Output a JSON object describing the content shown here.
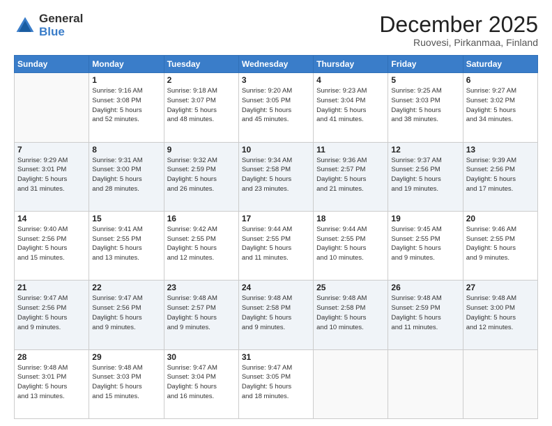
{
  "logo": {
    "general": "General",
    "blue": "Blue"
  },
  "header": {
    "month": "December 2025",
    "location": "Ruovesi, Pirkanmaa, Finland"
  },
  "weekdays": [
    "Sunday",
    "Monday",
    "Tuesday",
    "Wednesday",
    "Thursday",
    "Friday",
    "Saturday"
  ],
  "weeks": [
    [
      {
        "day": "",
        "info": ""
      },
      {
        "day": "1",
        "info": "Sunrise: 9:16 AM\nSunset: 3:08 PM\nDaylight: 5 hours\nand 52 minutes."
      },
      {
        "day": "2",
        "info": "Sunrise: 9:18 AM\nSunset: 3:07 PM\nDaylight: 5 hours\nand 48 minutes."
      },
      {
        "day": "3",
        "info": "Sunrise: 9:20 AM\nSunset: 3:05 PM\nDaylight: 5 hours\nand 45 minutes."
      },
      {
        "day": "4",
        "info": "Sunrise: 9:23 AM\nSunset: 3:04 PM\nDaylight: 5 hours\nand 41 minutes."
      },
      {
        "day": "5",
        "info": "Sunrise: 9:25 AM\nSunset: 3:03 PM\nDaylight: 5 hours\nand 38 minutes."
      },
      {
        "day": "6",
        "info": "Sunrise: 9:27 AM\nSunset: 3:02 PM\nDaylight: 5 hours\nand 34 minutes."
      }
    ],
    [
      {
        "day": "7",
        "info": "Sunrise: 9:29 AM\nSunset: 3:01 PM\nDaylight: 5 hours\nand 31 minutes."
      },
      {
        "day": "8",
        "info": "Sunrise: 9:31 AM\nSunset: 3:00 PM\nDaylight: 5 hours\nand 28 minutes."
      },
      {
        "day": "9",
        "info": "Sunrise: 9:32 AM\nSunset: 2:59 PM\nDaylight: 5 hours\nand 26 minutes."
      },
      {
        "day": "10",
        "info": "Sunrise: 9:34 AM\nSunset: 2:58 PM\nDaylight: 5 hours\nand 23 minutes."
      },
      {
        "day": "11",
        "info": "Sunrise: 9:36 AM\nSunset: 2:57 PM\nDaylight: 5 hours\nand 21 minutes."
      },
      {
        "day": "12",
        "info": "Sunrise: 9:37 AM\nSunset: 2:56 PM\nDaylight: 5 hours\nand 19 minutes."
      },
      {
        "day": "13",
        "info": "Sunrise: 9:39 AM\nSunset: 2:56 PM\nDaylight: 5 hours\nand 17 minutes."
      }
    ],
    [
      {
        "day": "14",
        "info": "Sunrise: 9:40 AM\nSunset: 2:56 PM\nDaylight: 5 hours\nand 15 minutes."
      },
      {
        "day": "15",
        "info": "Sunrise: 9:41 AM\nSunset: 2:55 PM\nDaylight: 5 hours\nand 13 minutes."
      },
      {
        "day": "16",
        "info": "Sunrise: 9:42 AM\nSunset: 2:55 PM\nDaylight: 5 hours\nand 12 minutes."
      },
      {
        "day": "17",
        "info": "Sunrise: 9:44 AM\nSunset: 2:55 PM\nDaylight: 5 hours\nand 11 minutes."
      },
      {
        "day": "18",
        "info": "Sunrise: 9:44 AM\nSunset: 2:55 PM\nDaylight: 5 hours\nand 10 minutes."
      },
      {
        "day": "19",
        "info": "Sunrise: 9:45 AM\nSunset: 2:55 PM\nDaylight: 5 hours\nand 9 minutes."
      },
      {
        "day": "20",
        "info": "Sunrise: 9:46 AM\nSunset: 2:55 PM\nDaylight: 5 hours\nand 9 minutes."
      }
    ],
    [
      {
        "day": "21",
        "info": "Sunrise: 9:47 AM\nSunset: 2:56 PM\nDaylight: 5 hours\nand 9 minutes."
      },
      {
        "day": "22",
        "info": "Sunrise: 9:47 AM\nSunset: 2:56 PM\nDaylight: 5 hours\nand 9 minutes."
      },
      {
        "day": "23",
        "info": "Sunrise: 9:48 AM\nSunset: 2:57 PM\nDaylight: 5 hours\nand 9 minutes."
      },
      {
        "day": "24",
        "info": "Sunrise: 9:48 AM\nSunset: 2:58 PM\nDaylight: 5 hours\nand 9 minutes."
      },
      {
        "day": "25",
        "info": "Sunrise: 9:48 AM\nSunset: 2:58 PM\nDaylight: 5 hours\nand 10 minutes."
      },
      {
        "day": "26",
        "info": "Sunrise: 9:48 AM\nSunset: 2:59 PM\nDaylight: 5 hours\nand 11 minutes."
      },
      {
        "day": "27",
        "info": "Sunrise: 9:48 AM\nSunset: 3:00 PM\nDaylight: 5 hours\nand 12 minutes."
      }
    ],
    [
      {
        "day": "28",
        "info": "Sunrise: 9:48 AM\nSunset: 3:01 PM\nDaylight: 5 hours\nand 13 minutes."
      },
      {
        "day": "29",
        "info": "Sunrise: 9:48 AM\nSunset: 3:03 PM\nDaylight: 5 hours\nand 15 minutes."
      },
      {
        "day": "30",
        "info": "Sunrise: 9:47 AM\nSunset: 3:04 PM\nDaylight: 5 hours\nand 16 minutes."
      },
      {
        "day": "31",
        "info": "Sunrise: 9:47 AM\nSunset: 3:05 PM\nDaylight: 5 hours\nand 18 minutes."
      },
      {
        "day": "",
        "info": ""
      },
      {
        "day": "",
        "info": ""
      },
      {
        "day": "",
        "info": ""
      }
    ]
  ]
}
